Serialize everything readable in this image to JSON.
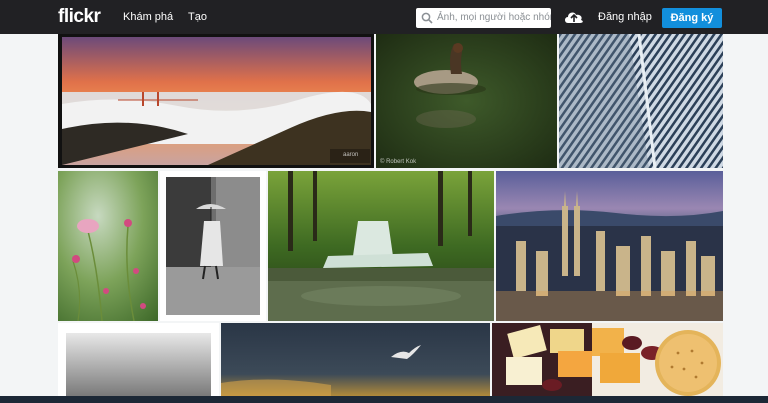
{
  "header": {
    "logo": "flickr",
    "nav": [
      "Khám phá",
      "Tạo"
    ],
    "search_placeholder": "Ảnh, mọi người hoặc nhóm",
    "login_label": "Đăng nhập",
    "signup_label": "Đăng ký"
  },
  "photos": {
    "p2_credit": "© Robert Kok",
    "p1_watermark": "aaron"
  },
  "colors": {
    "topbar": "#212124",
    "signup": "#128fdc"
  }
}
